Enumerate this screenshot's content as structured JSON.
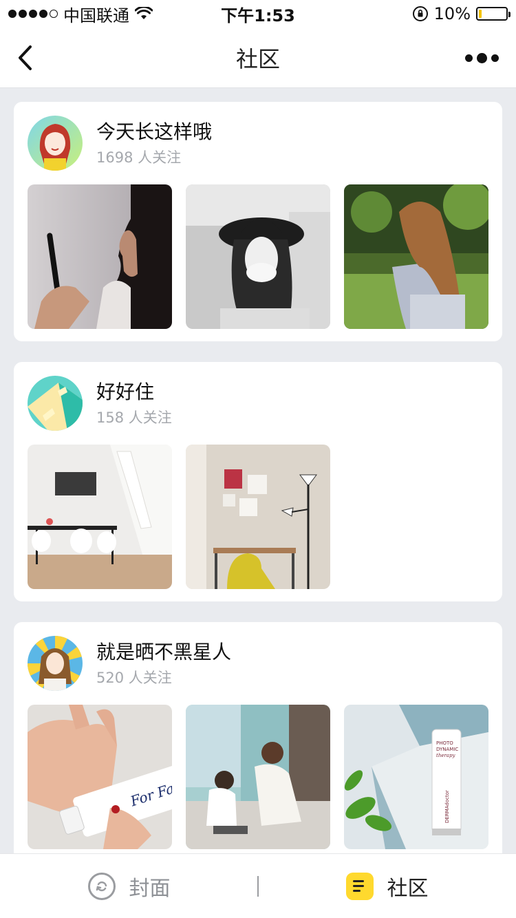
{
  "status_bar": {
    "carrier": "中国联通",
    "time": "下午1:53",
    "battery": "10%",
    "battery_level": 0.1
  },
  "nav": {
    "title": "社区"
  },
  "groups": [
    {
      "title": "今天长这样哦",
      "followers": "1698 人关注",
      "avatar_icon": "illustrated-girl-avatar",
      "photos": [
        "woman-with-mirror-photo",
        "woman-in-hat-photo",
        "woman-long-hair-photo"
      ]
    },
    {
      "title": "好好住",
      "followers": "158 人关注",
      "avatar_icon": "house-window-avatar",
      "photos": [
        "meeting-room-photo",
        "floor-lamp-room-photo"
      ]
    },
    {
      "title": "就是晒不黑星人",
      "followers": "520 人关注",
      "avatar_icon": "sunshine-girl-avatar",
      "photos": [
        "sunscreen-hand-photo",
        "mother-child-photo",
        "skincare-bottle-photo"
      ],
      "product_text": {
        "tube_brand": "For Fan",
        "bottle_line1": "PHOTO",
        "bottle_line2": "DYNAMIC",
        "bottle_line3": "therapy",
        "bottle_brand": "DERMAdoctor"
      }
    }
  ],
  "tab_bar": {
    "cover_label": "封面",
    "community_label": "社区"
  },
  "colors": {
    "accent": "#ffd92e",
    "background": "#e9ebef",
    "muted_text": "#a5a8ad"
  }
}
